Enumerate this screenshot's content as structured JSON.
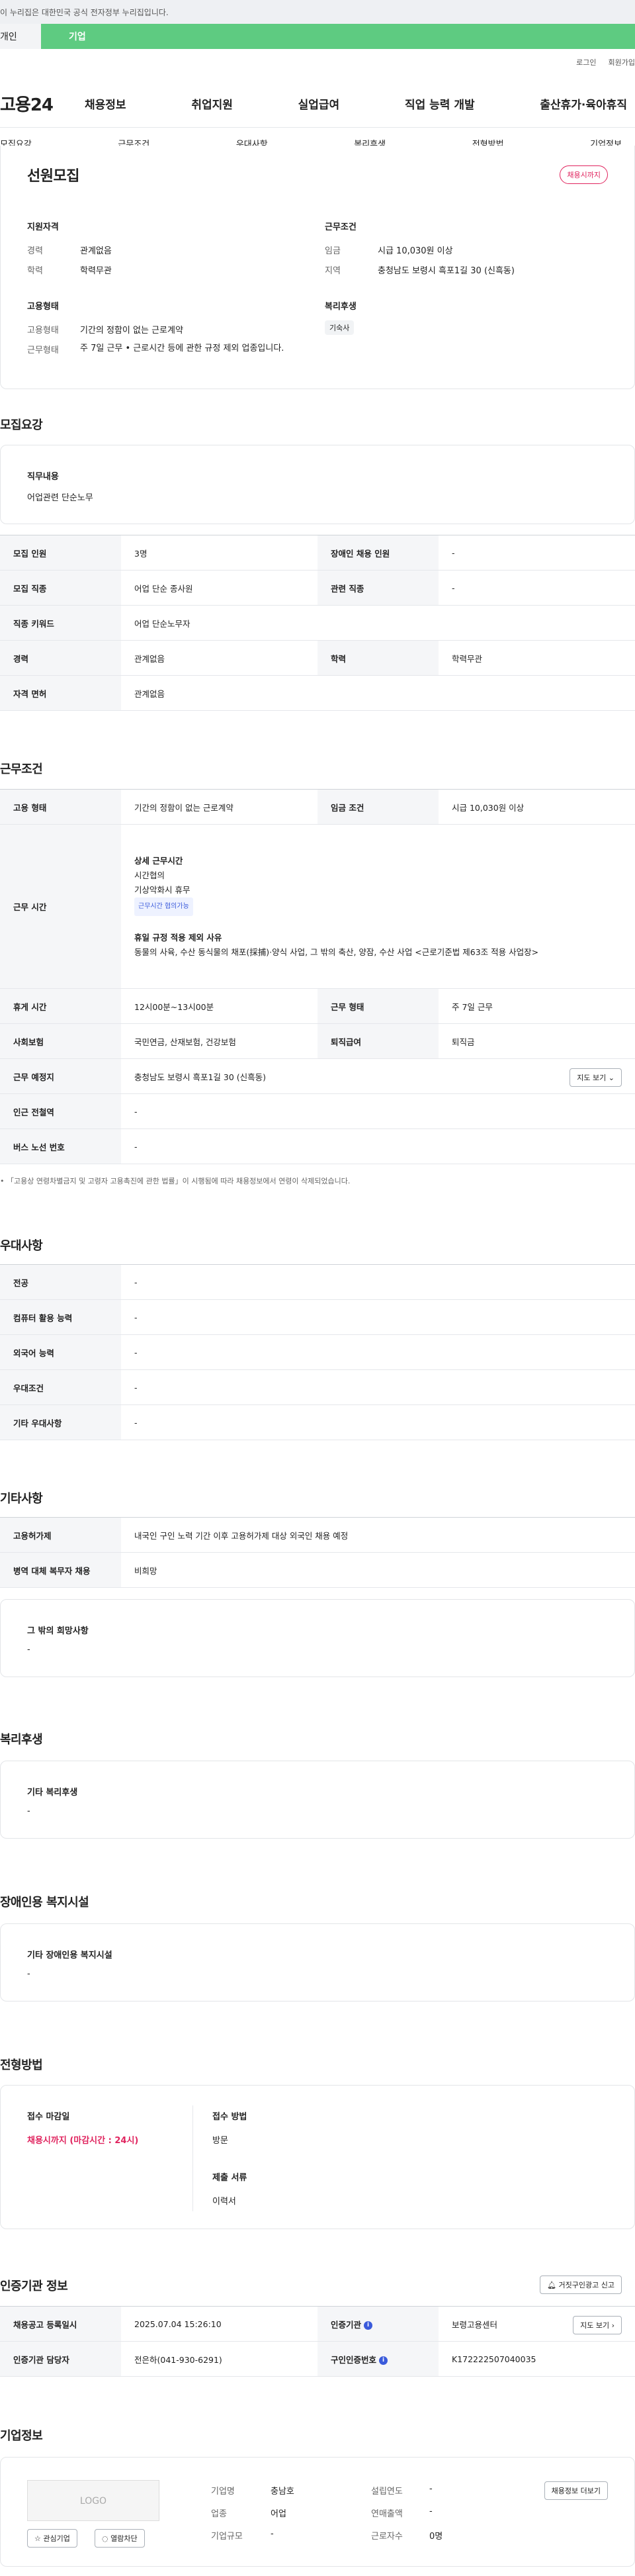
{
  "notice": "이 누리집은 대한민국 공식 전자정부 누리집입니다.",
  "tabs": {
    "personal": "개인",
    "company": "기업"
  },
  "util": {
    "login": "로그인",
    "join": "회원가입"
  },
  "logo": "고용24",
  "gnb": [
    "채용정보",
    "취업지원",
    "실업급여",
    "직업 능력 개발",
    "출산휴가·육아휴직"
  ],
  "subnav": [
    "모집요강",
    "근무조건",
    "우대사항",
    "복리후생",
    "전형방법",
    "기업정보"
  ],
  "summary": {
    "title": "선원모집",
    "status": "채용시까지",
    "qual_title": "지원자격",
    "career_label": "경력",
    "career": "관계없음",
    "edu_label": "학력",
    "edu": "학력무관",
    "cond_title": "근무조건",
    "wage_label": "임금",
    "wage": "시급 10,030원 이상",
    "region_label": "지역",
    "region": "충청남도 보령시 흑포1길 30 (신흑동)",
    "emp_title": "고용형태",
    "emptype_label": "고용형태",
    "emptype": "기간의 정함이 없는 근로계약",
    "worktype_label": "근무형태",
    "worktype": "주 7일 근무 • 근로시간 등에 관한 규정 제외 업종입니다.",
    "welfare_title": "복리후생",
    "welfare_tag": "기숙사"
  },
  "recruit": {
    "title": "모집요강",
    "job_title": "직무내용",
    "job_desc": "어업관련 단순노무",
    "rows": {
      "count_h": "모집 인원",
      "count": "3명",
      "disabled_h": "장애인 채용 인원",
      "disabled": "-",
      "occupation_h": "모집 직종",
      "occupation": "어업 단순 종사원",
      "related_h": "관련 직종",
      "related": "-",
      "keyword_h": "직종 키워드",
      "keyword": "어업 단순노무자",
      "career_h": "경력",
      "career": "관계없음",
      "edu_h": "학력",
      "edu": "학력무관",
      "license_h": "자격 면허",
      "license": "관계없음"
    }
  },
  "work": {
    "title": "근무조건",
    "emptype_h": "고용 형태",
    "emptype": "기간의 정함이 없는 근로계약",
    "wage_h": "임금 조건",
    "wage": "시급 10,030원 이상",
    "hours_h": "근무 시간",
    "hours_detail_title": "상세 근무시간",
    "hours_line1": "시간협의",
    "hours_line2": "기상악화시 휴무",
    "hours_badge": "근무시간 협의가능",
    "exempt_title": "휴일 규정 적용 제외 사유",
    "exempt_desc": "동물의 사육, 수산 동식물의 채포(採捕)·양식 사업, 그 밖의 축산, 양잠, 수산 사업 <근로기준법 제63조 적용 사업장>",
    "break_h": "휴게 시간",
    "break": "12시00분~13시00분",
    "form_h": "근무 형태",
    "form": "주 7일 근무",
    "insurance_h": "사회보험",
    "insurance": "국민연금, 산재보험, 건강보험",
    "severance_h": "퇴직급여",
    "severance": "퇴직금",
    "place_h": "근무 예정지",
    "place": "충청남도 보령시 흑포1길 30 (신흑동)",
    "map_btn": "지도 보기",
    "subway_h": "인근 전철역",
    "subway": "-",
    "bus_h": "버스 노선 번호",
    "bus": "-",
    "footnote": "「고용상 연령차별금지 및 고령자 고용촉진에 관한 법률」이 시행됨에 따라 채용정보에서 연령이 삭제되었습니다."
  },
  "pref": {
    "title": "우대사항",
    "major_h": "전공",
    "major": "-",
    "computer_h": "컴퓨터 활용 능력",
    "computer": "-",
    "lang_h": "외국어 능력",
    "lang": "-",
    "cond_h": "우대조건",
    "cond": "-",
    "etc_h": "기타 우대사항",
    "etc": "-"
  },
  "other": {
    "title": "기타사항",
    "visa_h": "고용허가제",
    "visa": "내국인 구인 노력 기간 이후 고용허가제 대상 외국인 채용 예정",
    "military_h": "병역 대체 복무자 채용",
    "military": "비희망",
    "extra_title": "그 밖의 희망사항",
    "extra": "-"
  },
  "welfare": {
    "title": "복리후생",
    "sub": "기타 복리후생",
    "val": "-"
  },
  "disability": {
    "title": "장애인용 복지시설",
    "sub": "기타 장애인용 복지시설",
    "val": "-"
  },
  "process": {
    "title": "전형방법",
    "deadline_h": "접수 마감일",
    "deadline": "채용시까지 (마감시간 : 24시)",
    "method_h": "접수 방법",
    "method": "방문",
    "docs_h": "제출 서류",
    "docs": "이력서"
  },
  "cert": {
    "title": "인증기관 정보",
    "report_btn": "거짓구인광고 신고",
    "reg_h": "채용공고 등록일시",
    "reg": "2025.07.04 15:26:10",
    "org_h": "인증기관",
    "org": "보령고용센터",
    "map_btn": "지도 보기",
    "manager_h": "인증기관 담당자",
    "manager": "전은하(041-930-6291)",
    "certno_h": "구인인증번호",
    "certno": "K172222507040035"
  },
  "company": {
    "title": "기업정보",
    "logo_text": "LOGO",
    "fav_btn": "관심기업",
    "block_btn": "열람차단",
    "name_h": "기업명",
    "name": "충남호",
    "industry_h": "업종",
    "industry": "어업",
    "size_h": "기업규모",
    "size": "-",
    "founded_h": "설립연도",
    "founded": "-",
    "sales_h": "연매출액",
    "sales": "-",
    "workers_h": "근로자수",
    "workers": "0명",
    "more_btn": "채용정보 더보기"
  }
}
